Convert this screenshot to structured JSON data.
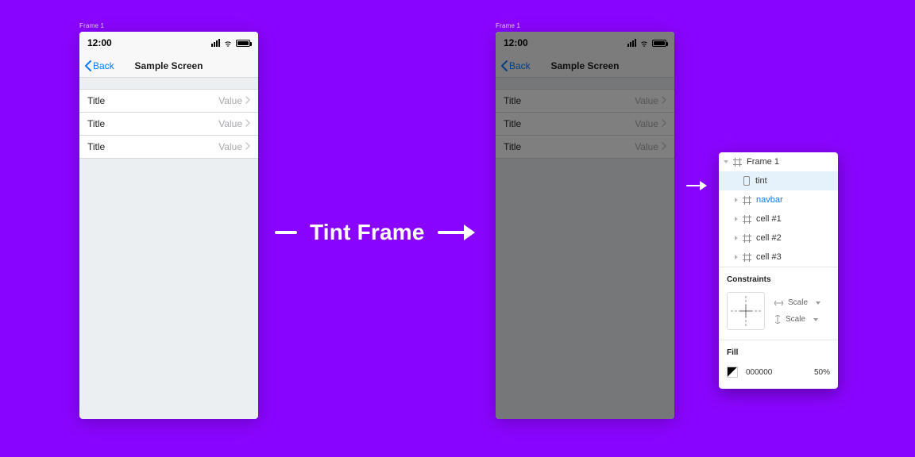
{
  "frame_label": "Frame 1",
  "phone": {
    "time": "12:00",
    "back_label": "Back",
    "nav_title": "Sample Screen",
    "cells": [
      {
        "title": "Title",
        "value": "Value"
      },
      {
        "title": "Title",
        "value": "Value"
      },
      {
        "title": "Title",
        "value": "Value"
      }
    ]
  },
  "center_label": "Tint Frame",
  "panel": {
    "layers": [
      {
        "name": "Frame 1",
        "kind": "frame",
        "expanded": true,
        "selected": false,
        "link": false,
        "indent": 0
      },
      {
        "name": "tint",
        "kind": "rect",
        "expanded": false,
        "selected": true,
        "link": false,
        "indent": 1
      },
      {
        "name": "navbar",
        "kind": "frame",
        "expanded": false,
        "selected": false,
        "link": true,
        "indent": 1
      },
      {
        "name": "cell #1",
        "kind": "frame",
        "expanded": false,
        "selected": false,
        "link": false,
        "indent": 1
      },
      {
        "name": "cell #2",
        "kind": "frame",
        "expanded": false,
        "selected": false,
        "link": false,
        "indent": 1
      },
      {
        "name": "cell #3",
        "kind": "frame",
        "expanded": false,
        "selected": false,
        "link": false,
        "indent": 1
      }
    ],
    "constraints_header": "Constraints",
    "scale_label": "Scale",
    "fill_header": "Fill",
    "fill_hex": "000000",
    "fill_opacity": "50%"
  }
}
